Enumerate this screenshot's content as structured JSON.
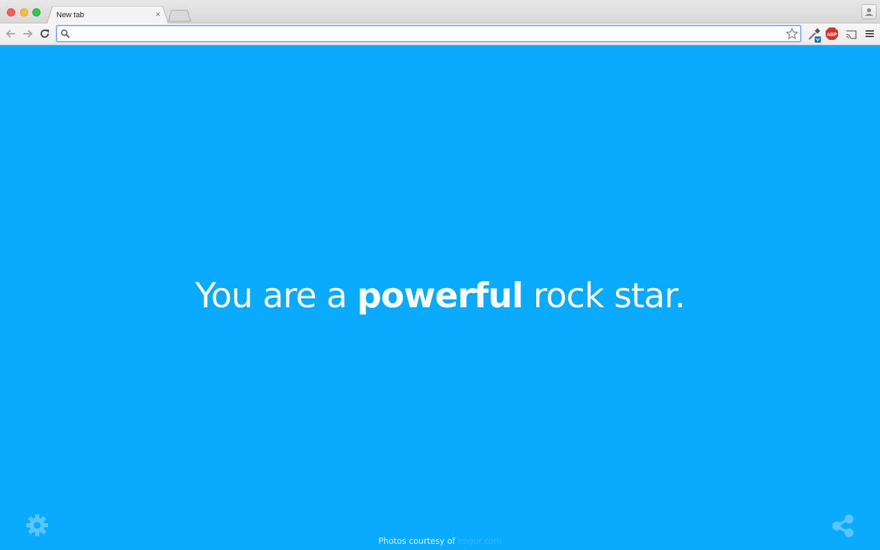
{
  "browser": {
    "tab": {
      "title": "New tab",
      "close_glyph": "×"
    },
    "new_tab_icon": "new-tab-icon",
    "profile_icon": "profile-icon",
    "toolbar": {
      "back_icon": "back-arrow-icon",
      "forward_icon": "forward-arrow-icon",
      "reload_icon": "reload-icon",
      "omnibox": {
        "value": "",
        "placeholder": "",
        "search_icon": "search-icon",
        "bookmark_icon": "star-icon"
      },
      "extensions": [
        {
          "name": "eyedropper-icon"
        },
        {
          "name": "adblock-icon",
          "label": "ABP"
        },
        {
          "name": "cast-icon"
        },
        {
          "name": "menu-icon"
        }
      ]
    }
  },
  "page": {
    "headline": {
      "before": "You are a ",
      "emphasis": "powerful",
      "after": " rock star."
    },
    "credit": {
      "text": "Photos courtesy of ",
      "link": "Imgur.com"
    },
    "settings_icon": "gear-icon",
    "share_icon": "share-icon"
  },
  "colors": {
    "background": "#0aabff",
    "headline": "#ffffff",
    "credit_link": "#34b6ff",
    "icon_fill": "#5ac4ff"
  }
}
